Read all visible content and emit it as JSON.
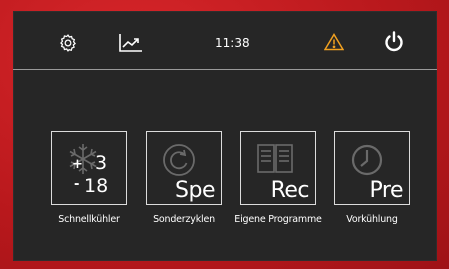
{
  "topbar": {
    "time": "11:38",
    "icons": [
      "gear-icon",
      "chart-icon",
      "warning-icon",
      "power-icon"
    ],
    "warning_color": "#f0a020"
  },
  "tiles": [
    {
      "label": "Schnellkühler",
      "icon": "snowflake-icon",
      "plus": "+",
      "minus": "-",
      "upper": "3",
      "lower": "18"
    },
    {
      "label": "Sonderzyklen",
      "icon": "cycle-icon",
      "abbr": "Spe"
    },
    {
      "label": "Eigene Programme",
      "icon": "book-icon",
      "abbr": "Rec"
    },
    {
      "label": "Vorkühlung",
      "icon": "clock-icon",
      "abbr": "Pre"
    }
  ],
  "colors": {
    "frame": "#c81e22",
    "screen": "#262626",
    "text": "#ffffff"
  }
}
